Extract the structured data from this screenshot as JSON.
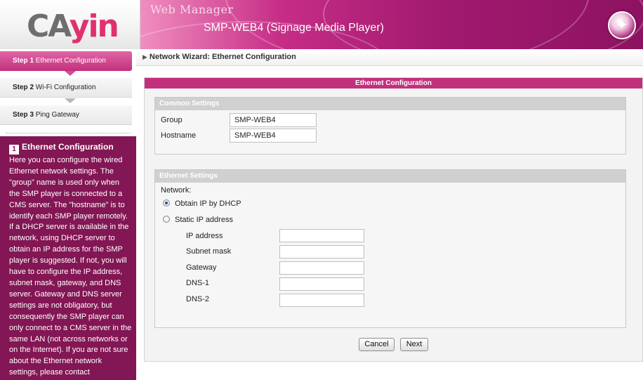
{
  "header": {
    "logo_part1": "CA",
    "logo_part2": "yin",
    "app_title": "Web Manager",
    "device_title": "SMP-WEB4 (Signage Media Player)",
    "wizard_icon": "magic-wand-icon"
  },
  "sidebar": {
    "steps": [
      {
        "number": "Step 1",
        "label": "Ethernet Configuration",
        "state": "active"
      },
      {
        "number": "Step 2",
        "label": "Wi-Fi Configuration",
        "state": "inactive"
      },
      {
        "number": "Step 3",
        "label": "Ping Gateway",
        "state": "inactive"
      }
    ],
    "help": {
      "badge": "1",
      "title": "Ethernet Configuration",
      "body": "Here you can configure the wired Ethernet network settings. The \"group\" name is used only when the SMP player is connected to a CMS server. The \"hostname\" is to identify each SMP player remotely. If a DHCP server is available in the network, using DHCP server to obtain an IP address for the SMP player is suggested. If not, you will have to configure the IP address, subnet mask, gateway, and DNS server. Gateway and DNS server settings are not obligatory, but consequently the SMP player can only connect to a CMS server in the same LAN (not across networks or on the Internet). If you are not sure about the Ethernet network settings, please contact"
    }
  },
  "breadcrumb": "Network Wizard: Ethernet Configuration",
  "panel": {
    "title": "Ethernet Configuration",
    "common": {
      "header": "Common Settings",
      "group_label": "Group",
      "group_value": "SMP-WEB4",
      "hostname_label": "Hostname",
      "hostname_value": "SMP-WEB4"
    },
    "ethernet": {
      "header": "Ethernet Settings",
      "network_label": "Network:",
      "dhcp_label": "Obtain IP by DHCP",
      "static_label": "Static IP address",
      "selected": "dhcp",
      "fields": {
        "ip_label": "IP address",
        "ip_value": "",
        "subnet_label": "Subnet mask",
        "subnet_value": "",
        "gateway_label": "Gateway",
        "gateway_value": "",
        "dns1_label": "DNS-1",
        "dns1_value": "",
        "dns2_label": "DNS-2",
        "dns2_value": ""
      }
    },
    "buttons": {
      "cancel": "Cancel",
      "next": "Next"
    }
  },
  "colors": {
    "accent": "#c2307d",
    "help_bg": "#831654",
    "section_header": "#d0d0d0"
  }
}
